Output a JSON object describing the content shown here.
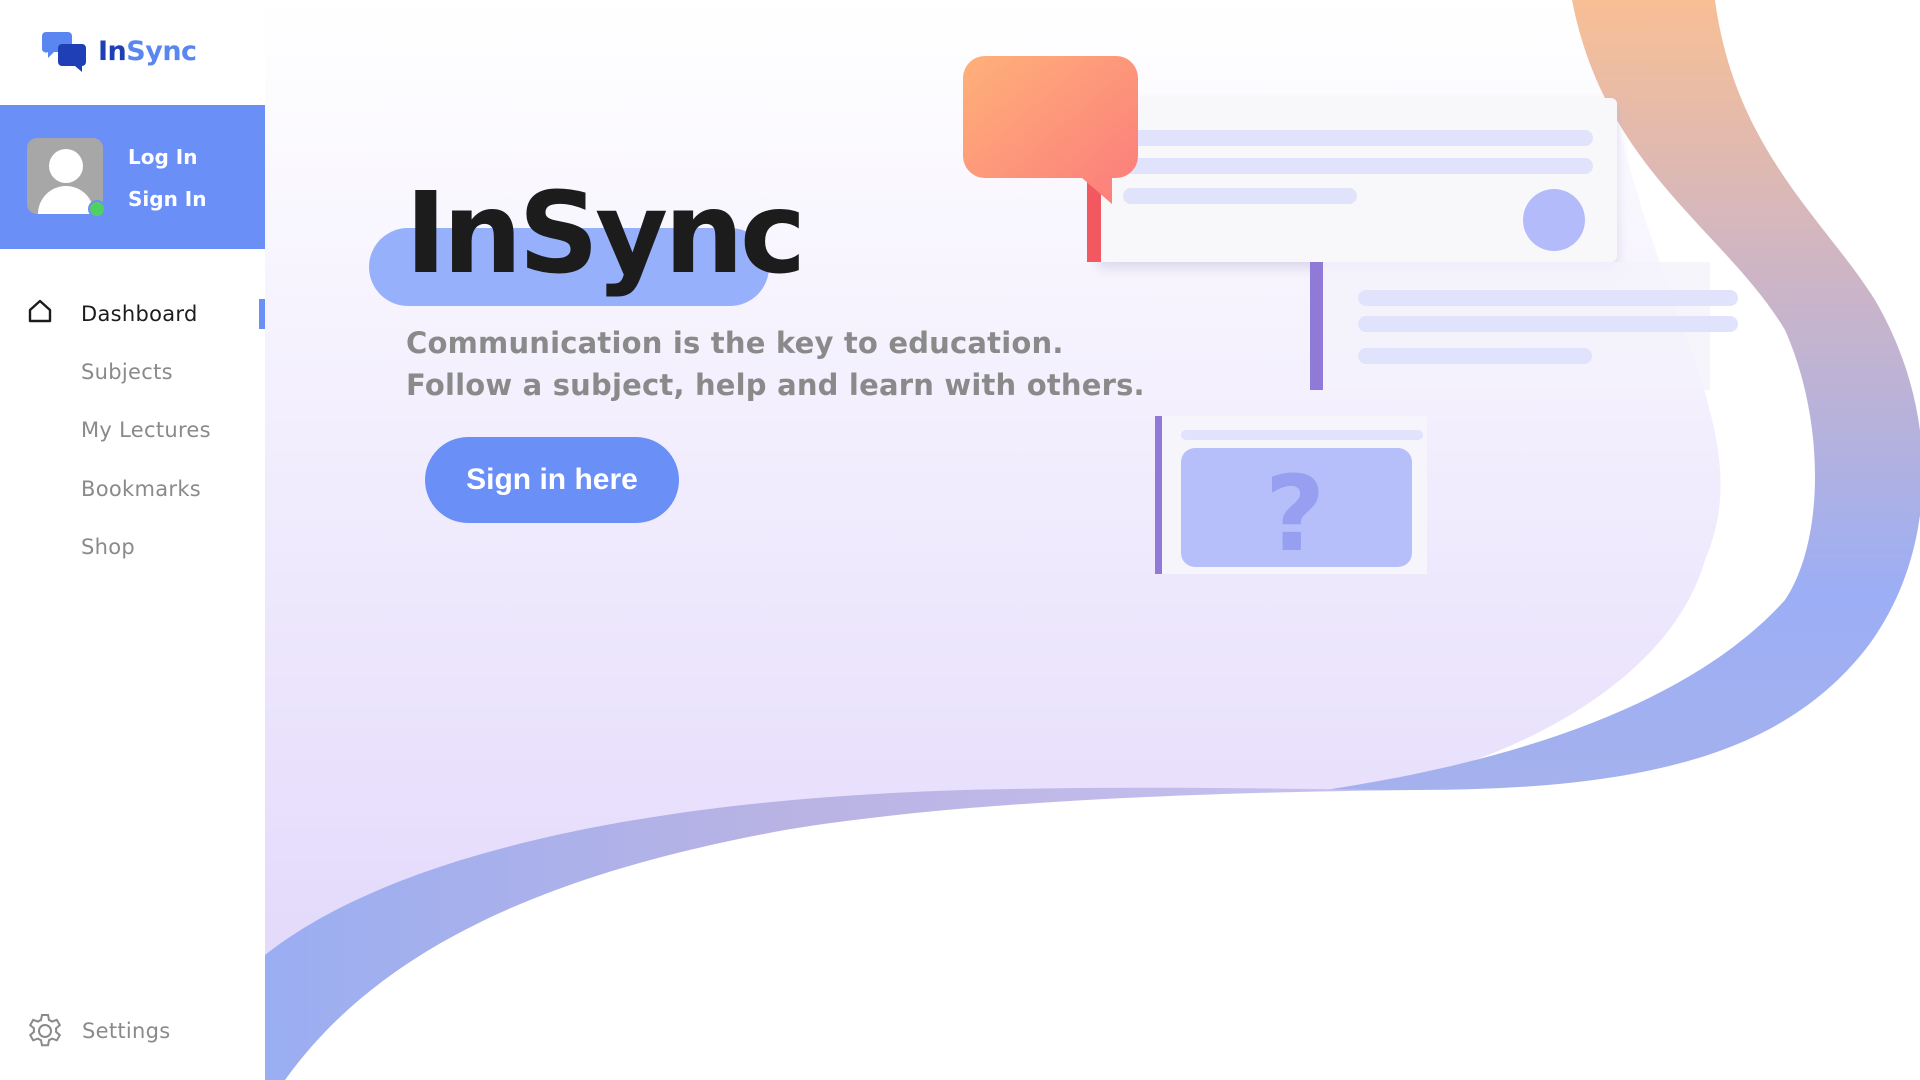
{
  "brand": {
    "part1": "In",
    "part2": "Sync",
    "logo_icon": "chat-bubbles-icon"
  },
  "user_panel": {
    "login_label": "Log In",
    "signin_label": "Sign In",
    "avatar_icon": "user-avatar-icon",
    "status": "online"
  },
  "nav": {
    "items": [
      {
        "label": "Dashboard",
        "icon": "home-icon",
        "active": true
      },
      {
        "label": "Subjects"
      },
      {
        "label": "My Lectures"
      },
      {
        "label": "Bookmarks"
      },
      {
        "label": "Shop"
      }
    ],
    "settings_label": "Settings",
    "settings_icon": "gear-icon"
  },
  "hero": {
    "title": "InSync",
    "tagline_line1": "Communication is the key to education.",
    "tagline_line2": "Follow a subject, help and learn with others.",
    "cta_label": "Sign in here"
  },
  "colors": {
    "accent": "#6a90f7",
    "brand_dark": "#1f3fb6",
    "status_online": "#4fd161",
    "bubble_start": "#ffb17a",
    "bubble_end": "#fb7b7b"
  }
}
